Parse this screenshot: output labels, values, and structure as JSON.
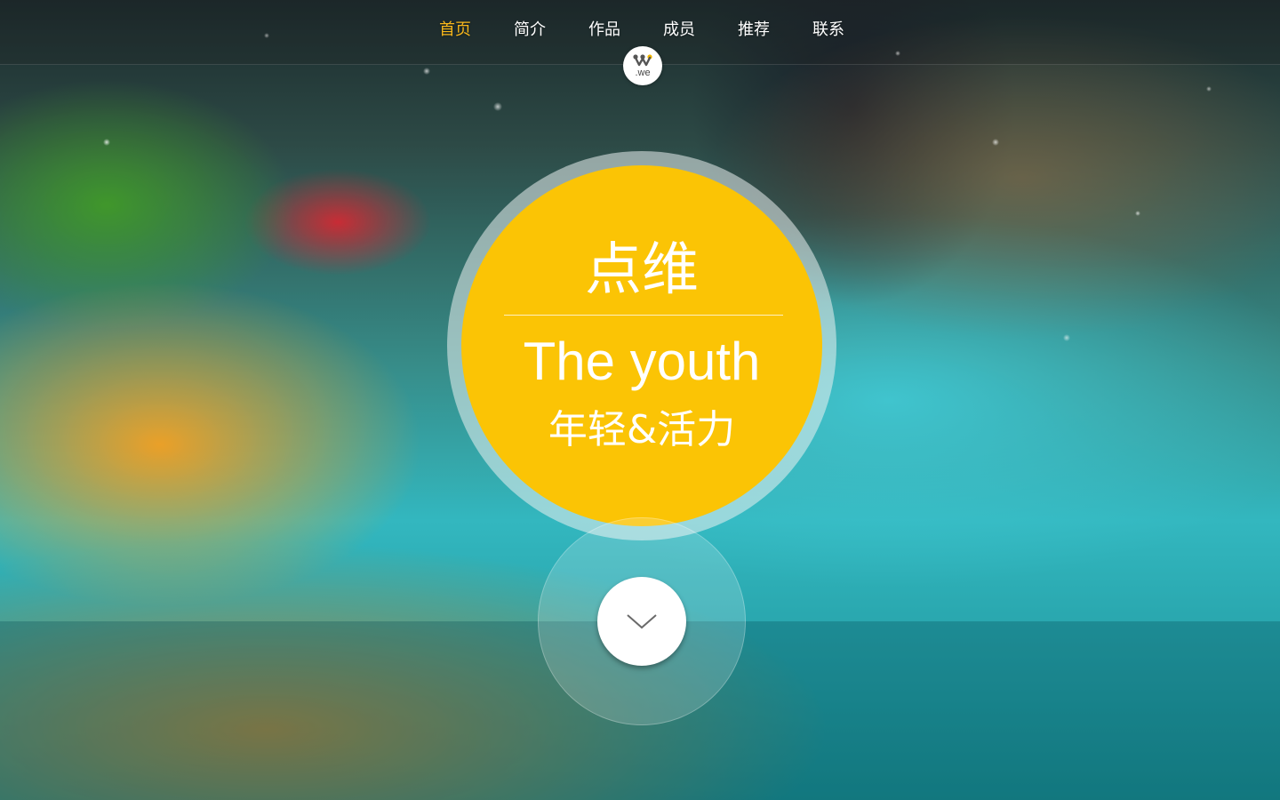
{
  "nav": {
    "items": [
      {
        "label": "首页",
        "active": true
      },
      {
        "label": "简介",
        "active": false
      },
      {
        "label": "作品",
        "active": false
      },
      {
        "label": "成员",
        "active": false
      },
      {
        "label": "推荐",
        "active": false
      },
      {
        "label": "联系",
        "active": false
      }
    ],
    "active_color": "#f7b71b"
  },
  "logo": {
    "text": ".we",
    "icon": "w-logo-icon"
  },
  "hero": {
    "title": "点维",
    "subtitle_en": "The youth",
    "subtitle_cn": "年轻&活力",
    "circle_color": "#fbc405"
  },
  "scroll": {
    "icon": "chevron-down-icon"
  }
}
